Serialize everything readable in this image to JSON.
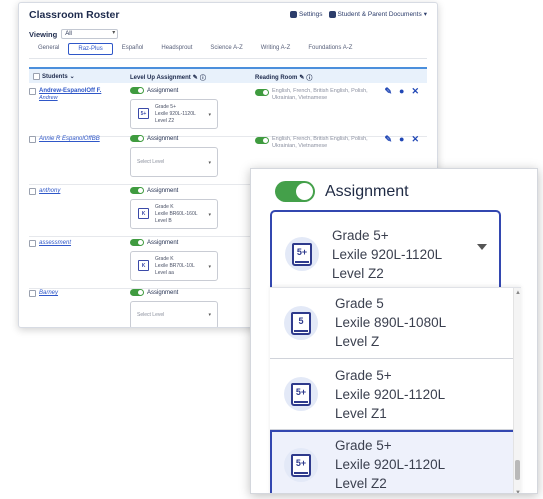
{
  "roster": {
    "title": "Classroom Roster",
    "settings_label": "Settings",
    "documents_label": "Student & Parent Documents",
    "viewing_label": "Viewing",
    "viewing_value": "All",
    "tabs": [
      "General",
      "Raz-Plus",
      "Español",
      "Headsprout",
      "Science A-Z",
      "Writing A-Z",
      "Foundations A-Z"
    ],
    "active_tab": "Raz-Plus",
    "columns": {
      "students": "Students",
      "level_up": "Level Up Assignment",
      "reading_room": "Reading Room"
    },
    "assignment_label": "Assignment",
    "select_level_placeholder": "Select Level",
    "reading_room_languages": "English, French, British English, Polish, Ukrainian, Vietnamese",
    "rows": [
      {
        "name": "Andrew-EspanolOff F.",
        "sub_name": "Andrew",
        "level": [
          "Grade 5+",
          "Lexile 920L-1120L",
          "Level Z2"
        ],
        "badge": "5+"
      },
      {
        "name": "Annie R EspanolOffBB",
        "sub_name": "",
        "level": null,
        "badge": ""
      },
      {
        "name": "anthony",
        "sub_name": "",
        "level": [
          "Grade K",
          "Lexile BR60L-160L",
          "Level B"
        ],
        "badge": "K"
      },
      {
        "name": "assessment",
        "sub_name": "",
        "level": [
          "Grade K",
          "Lexile BR70L-10L",
          "Level aa"
        ],
        "badge": "K"
      },
      {
        "name": "Barney",
        "sub_name": "",
        "level": null,
        "badge": ""
      }
    ]
  },
  "zoom": {
    "assignment_label": "Assignment",
    "selected": {
      "badge": "5+",
      "grade": "Grade 5+",
      "lexile": "Lexile 920L-1120L",
      "level": "Level Z2"
    },
    "options": [
      {
        "badge": "5",
        "grade": "Grade 5",
        "lexile": "Lexile 890L-1080L",
        "level": "Level Z"
      },
      {
        "badge": "5+",
        "grade": "Grade 5+",
        "lexile": "Lexile 920L-1120L",
        "level": "Level Z1"
      },
      {
        "badge": "5+",
        "grade": "Grade 5+",
        "lexile": "Lexile 920L-1120L",
        "level": "Level Z2"
      }
    ]
  },
  "icons": {
    "settings": "gear-icon",
    "documents": "document-icon",
    "edit": "pencil-icon",
    "comment": "speech-bubble-icon",
    "remove": "close-icon",
    "info": "info-icon",
    "book": "book-icon"
  },
  "colors": {
    "toggle_on": "#44a04a",
    "accent": "#3347b0",
    "link": "#2f57c8"
  }
}
